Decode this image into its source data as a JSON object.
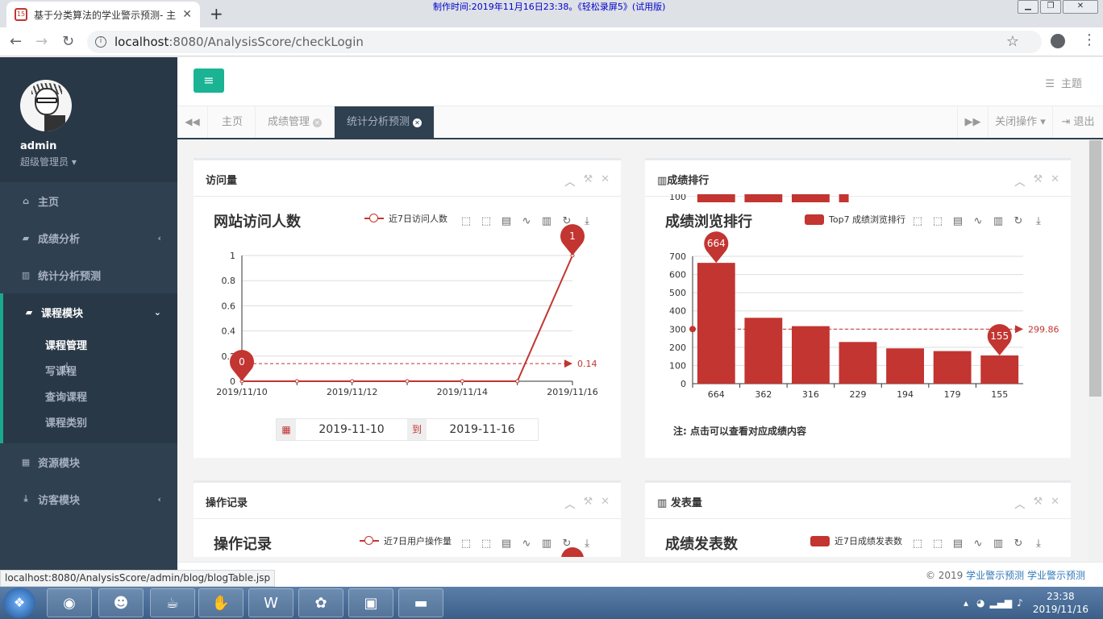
{
  "browser": {
    "tab_title": "基于分类算法的学业警示预测- 主",
    "tab_favicon": "15",
    "recording_banner": "制作时间:2019年11月16日23:38。《轻松录屏5》(试用版)",
    "url_host": "localhost",
    "url_rest": ":8080/AnalysisScore/checkLogin",
    "status_url": "localhost:8080/AnalysisScore/admin/blog/blogTable.jsp"
  },
  "sidebar": {
    "username": "admin",
    "role": "超级管理员",
    "items": [
      {
        "label": "主页",
        "icon": "home-icon"
      },
      {
        "label": "成绩分析",
        "icon": "book-icon"
      },
      {
        "label": "统计分析预测",
        "icon": "bar-chart-icon"
      },
      {
        "label": "课程模块",
        "icon": "book-icon"
      },
      {
        "label": "资源模块",
        "icon": "table-icon"
      },
      {
        "label": "访客模块",
        "icon": "download-icon"
      }
    ],
    "submenu": [
      "课程管理",
      "写课程",
      "查询课程",
      "课程类别"
    ]
  },
  "topnav": {
    "theme_label": "主题"
  },
  "tabs": {
    "items": [
      "主页",
      "成绩管理",
      "统计分析预测"
    ],
    "close_ops": "关闭操作",
    "logout": "退出"
  },
  "panels": {
    "visits": {
      "header": "访问量",
      "chart_title": "网站访问人数",
      "legend": "近7日访问人数",
      "date_from": "2019-11-10",
      "date_to_label": "到",
      "date_to": "2019-11-16"
    },
    "ranking": {
      "header": "成绩排行",
      "chart_title": "成绩浏览排行",
      "legend": "Top7 成绩浏览排行",
      "note": "注: 点击可以查看对应成绩内容"
    },
    "ops": {
      "header": "操作记录",
      "chart_title": "操作记录",
      "legend": "近7日用户操作量"
    },
    "publish": {
      "header": "发表量",
      "chart_title": "成绩发表数",
      "legend": "近7日成绩发表数"
    }
  },
  "footer": {
    "copyright": "© 2019",
    "link1": "学业警示预测",
    "link2": "学业警示预测"
  },
  "taskbar": {
    "time": "23:38",
    "date": "2019/11/16"
  },
  "colors": {
    "series": "#c23531",
    "sidebar_bg": "#2f4050",
    "accent": "#1ab394"
  },
  "chart_data": [
    {
      "type": "line",
      "title": "网站访问人数",
      "x": [
        "2019/11/10",
        "2019/11/11",
        "2019/11/12",
        "2019/11/13",
        "2019/11/14",
        "2019/11/15",
        "2019/11/16"
      ],
      "x_tick_labels": [
        "2019/11/10",
        "2019/11/12",
        "2019/11/14",
        "2019/11/16"
      ],
      "series": [
        {
          "name": "近7日访问人数",
          "values": [
            0,
            0,
            0,
            0,
            0,
            0,
            1
          ]
        }
      ],
      "y_ticks": [
        "0",
        "0.2",
        "0.4",
        "0.6",
        "0.8",
        "1"
      ],
      "ylim": [
        0,
        1
      ],
      "mark_points": [
        {
          "label": "0",
          "index": 0
        },
        {
          "label": "1",
          "index": 6
        }
      ],
      "mark_line": {
        "value": 0.14,
        "label": "0.14"
      },
      "grid": true
    },
    {
      "type": "bar",
      "title": "成绩浏览排行",
      "categories": [
        "664",
        "362",
        "316",
        "229",
        "194",
        "179",
        "155"
      ],
      "series": [
        {
          "name": "Top7 成绩浏览排行",
          "values": [
            664,
            362,
            316,
            229,
            194,
            179,
            155
          ]
        }
      ],
      "y_ticks": [
        "0",
        "100",
        "200",
        "300",
        "400",
        "500",
        "600",
        "700"
      ],
      "ylim": [
        0,
        700
      ],
      "mark_points": [
        {
          "label": "664",
          "index": 0
        },
        {
          "label": "155",
          "index": 6
        }
      ],
      "mark_line": {
        "value": 299.86,
        "label": "299.86"
      },
      "grid": true
    }
  ]
}
